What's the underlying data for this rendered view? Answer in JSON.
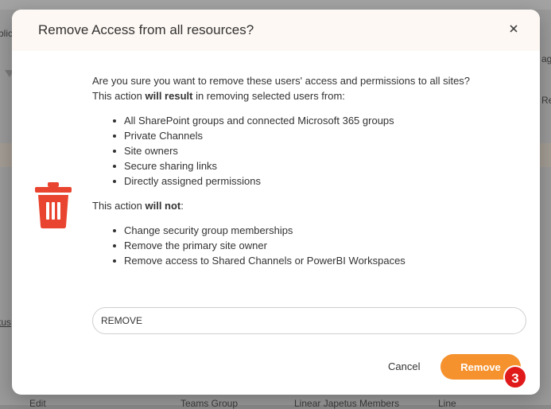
{
  "background": {
    "left_fragment_1": "blic",
    "left_fragment_2": "tus",
    "right_fragment_1": "ag",
    "right_fragment_2": "Re",
    "row_edit": "Edit",
    "row_type": "Teams Group",
    "row_members": "Linear Japetus Members",
    "row_extra": "Line"
  },
  "dialog": {
    "title": "Remove Access from all resources?",
    "close_icon": "close-icon",
    "trash_icon": "trash-icon",
    "accent_color": "#f5922e",
    "trash_color": "#e8442f",
    "question": "Are you sure you want to remove these users' access and permissions to all sites?",
    "result_prefix": "This action ",
    "result_bold": "will result",
    "result_suffix": " in removing selected users from:",
    "result_items": [
      "All SharePoint groups and connected Microsoft 365 groups",
      "Private Channels",
      "Site owners",
      "Secure sharing links",
      "Directly assigned permissions"
    ],
    "not_prefix": "This action ",
    "not_bold": "will not",
    "not_suffix": ":",
    "not_items": [
      "Change security group memberships",
      "Remove the primary site owner",
      "Remove access to Shared Channels or PowerBI Workspaces"
    ],
    "confirm_value": "REMOVE",
    "cancel_label": "Cancel",
    "remove_label": "Remove",
    "badge": "3"
  }
}
